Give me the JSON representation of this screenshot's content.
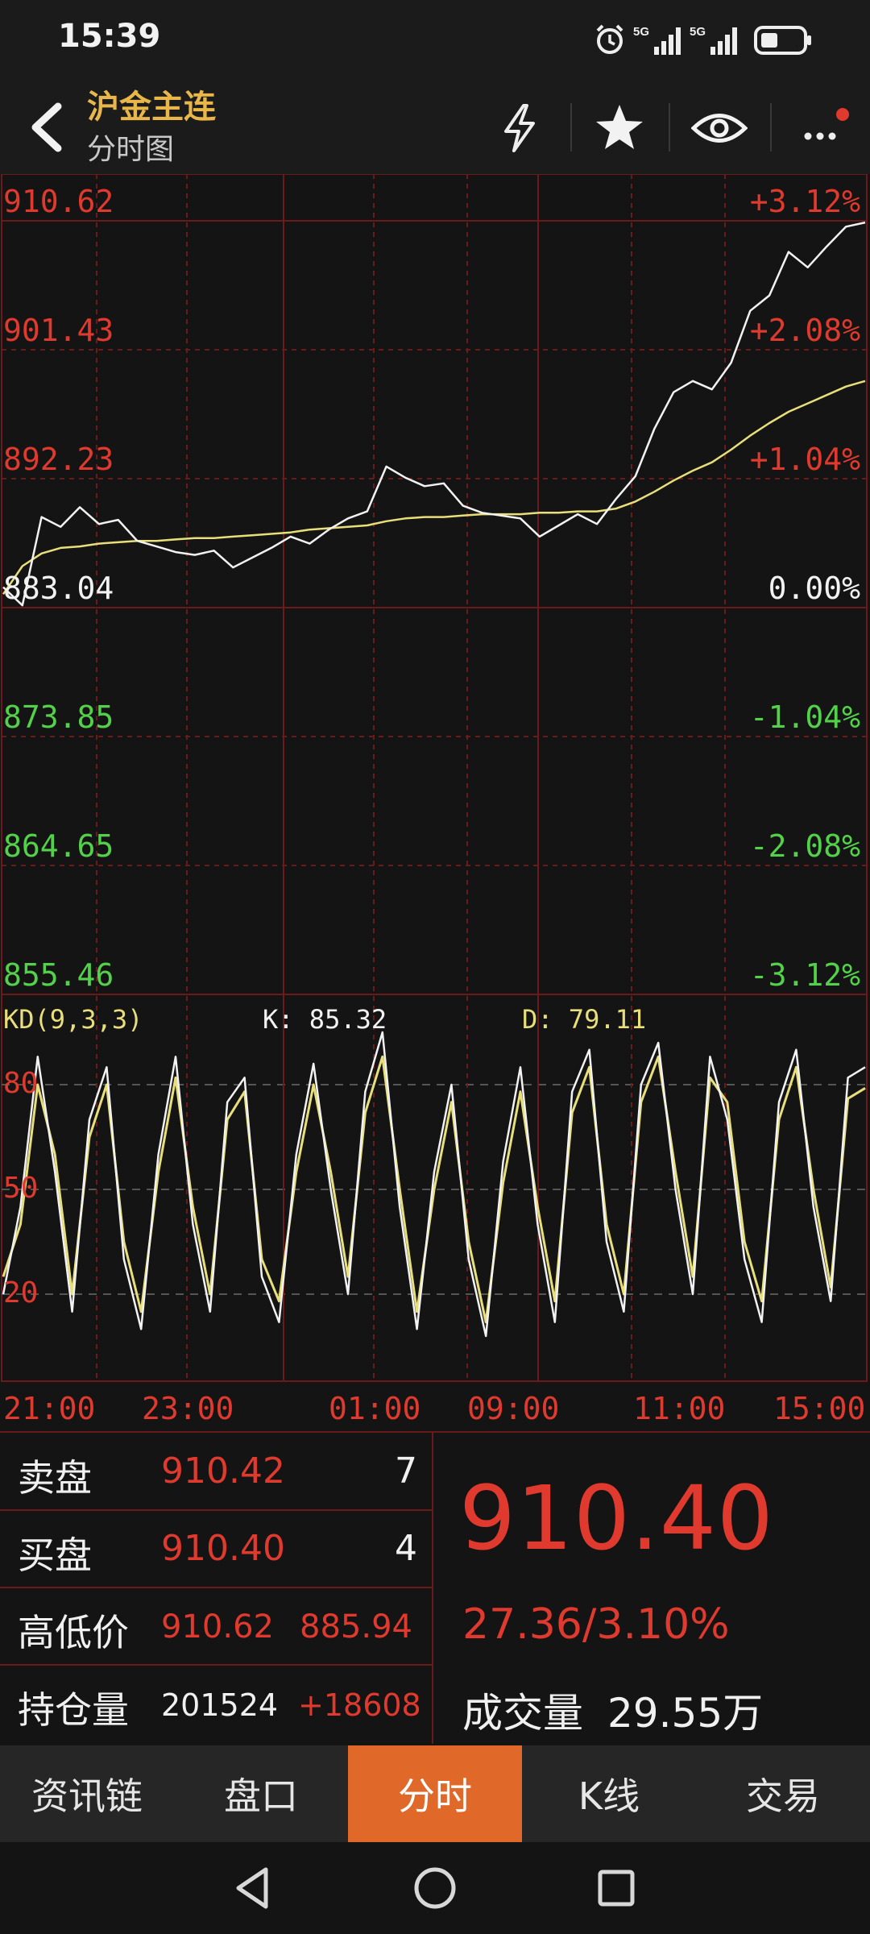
{
  "status_bar": {
    "time": "15:39"
  },
  "header": {
    "title": "沪金主连",
    "subtitle": "分时图"
  },
  "chart": {
    "price_labels_left": [
      "910.62",
      "901.43",
      "892.23",
      "883.04",
      "873.85",
      "864.65",
      "855.46"
    ],
    "pct_labels_right": [
      "+3.12%",
      "+2.08%",
      "+1.04%",
      "0.00%",
      "-1.04%",
      "-2.08%",
      "-3.12%"
    ],
    "kd_title": "KD(9,3,3)",
    "kd_k": "K: 85.32",
    "kd_d": "D: 79.11",
    "kd_levels": [
      "80",
      "50",
      "20"
    ],
    "time_labels": [
      "21:00",
      "23:00",
      "01:00",
      "09:00",
      "11:00",
      "15:00"
    ],
    "colors": {
      "up": "#e03a2e",
      "down": "#53d14a",
      "flat": "#f2f2f2",
      "avg": "#e8df7a",
      "grid": "#6a1a1a",
      "kd_d": "#e8df7a"
    }
  },
  "chart_data": [
    {
      "type": "line",
      "ylim": [
        855.46,
        910.62
      ],
      "reference_price": 883.04,
      "x_ticks": [
        "21:00",
        "23:00",
        "01:00",
        "09:00",
        "11:00",
        "15:00"
      ],
      "series": [
        {
          "values": [
            884.5,
            883.2,
            889.5,
            888.8,
            890.2,
            889.0,
            889.3,
            887.8,
            887.4,
            887.0,
            886.8,
            887.1,
            885.9,
            886.6,
            887.3,
            888.1,
            887.6,
            888.6,
            889.4,
            889.9,
            893.1,
            892.3,
            891.7,
            891.9,
            890.3,
            889.8,
            889.6,
            889.4,
            888.1,
            888.9,
            889.7,
            889.0,
            890.8,
            892.4,
            895.8,
            898.4,
            899.2,
            898.6,
            900.5,
            904.2,
            905.3,
            908.4,
            907.3,
            908.8,
            910.2,
            910.5
          ]
        },
        {
          "values": [
            884.0,
            886.0,
            886.9,
            887.3,
            887.4,
            887.6,
            887.7,
            887.8,
            887.8,
            887.9,
            888.0,
            888.0,
            888.1,
            888.2,
            888.3,
            888.4,
            888.6,
            888.7,
            888.8,
            888.9,
            889.2,
            889.4,
            889.5,
            889.5,
            889.6,
            889.7,
            889.7,
            889.7,
            889.8,
            889.8,
            889.9,
            889.9,
            890.1,
            890.6,
            891.3,
            892.1,
            892.8,
            893.4,
            894.3,
            895.3,
            896.2,
            897.0,
            897.6,
            898.2,
            898.8,
            899.2
          ]
        }
      ]
    },
    {
      "type": "line",
      "ylim": [
        0,
        100
      ],
      "x_ticks": [
        "21:00",
        "23:00",
        "01:00",
        "09:00",
        "11:00",
        "15:00"
      ],
      "series": [
        {
          "values": [
            20,
            45,
            88,
            55,
            15,
            70,
            85,
            30,
            10,
            60,
            88,
            40,
            15,
            75,
            82,
            25,
            12,
            60,
            86,
            50,
            20,
            78,
            95,
            45,
            10,
            55,
            80,
            30,
            8,
            58,
            85,
            40,
            12,
            78,
            90,
            35,
            15,
            80,
            92,
            50,
            20,
            88,
            70,
            30,
            12,
            75,
            90,
            45,
            18,
            82,
            85
          ]
        },
        {
          "values": [
            25,
            40,
            80,
            60,
            20,
            65,
            80,
            35,
            15,
            55,
            82,
            45,
            20,
            70,
            78,
            30,
            18,
            55,
            80,
            55,
            25,
            72,
            88,
            50,
            15,
            50,
            75,
            35,
            12,
            52,
            78,
            45,
            18,
            72,
            85,
            40,
            20,
            75,
            88,
            55,
            25,
            82,
            75,
            35,
            18,
            70,
            85,
            50,
            22,
            76,
            79
          ]
        }
      ]
    }
  ],
  "info": {
    "sell_label": "卖盘",
    "sell_price": "910.42",
    "sell_qty": "7",
    "buy_label": "买盘",
    "buy_price": "910.40",
    "buy_qty": "4",
    "hl_label": "高低价",
    "high": "910.62",
    "low": "885.94",
    "oi_label": "持仓量",
    "oi_value": "201524",
    "oi_change": "+18608",
    "last_price": "910.40",
    "change": "27.36/3.10%",
    "volume_label": "成交量",
    "volume_value": "29.55万"
  },
  "tabs": [
    "资讯链",
    "盘口",
    "分时",
    "K线",
    "交易"
  ],
  "active_tab": "分时"
}
